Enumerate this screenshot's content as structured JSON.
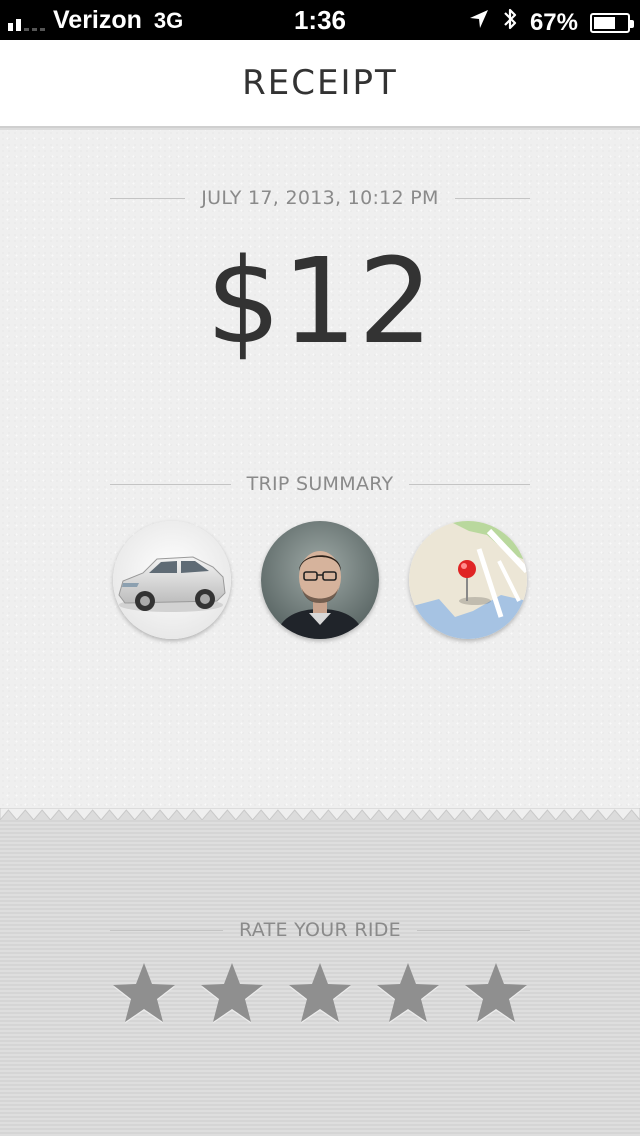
{
  "status_bar": {
    "carrier": "Verizon",
    "network": "3G",
    "time": "1:36",
    "battery_percent": "67%",
    "battery_level": 0.67,
    "signal_bars": 2,
    "icons": [
      "signal-icon",
      "location-arrow-icon",
      "bluetooth-icon",
      "battery-icon"
    ]
  },
  "nav": {
    "title": "RECEIPT"
  },
  "receipt": {
    "datetime": "JULY 17, 2013, 10:12 PM",
    "amount": "$12",
    "trip_summary_label": "TRIP SUMMARY",
    "summary_items": [
      {
        "name": "vehicle",
        "icon": "car-photo"
      },
      {
        "name": "driver",
        "icon": "driver-photo"
      },
      {
        "name": "map",
        "icon": "map-pin"
      }
    ]
  },
  "rating": {
    "label": "RATE YOUR RIDE",
    "max_stars": 5,
    "selected": 0,
    "colors": {
      "star": "#8f8f8f",
      "star_highlight": "#a7a7a7"
    }
  },
  "colors": {
    "status_bar_bg": "#000000",
    "nav_bg": "#ffffff",
    "receipt_bg": "#efefef",
    "rating_bg": "#d9d9d9",
    "text_dark": "#333333",
    "text_muted": "#8a8a8a"
  }
}
